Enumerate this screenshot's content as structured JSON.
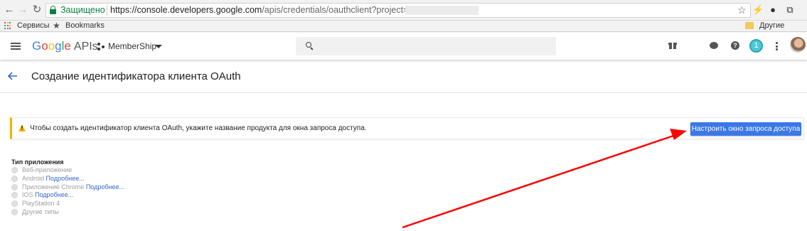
{
  "browser": {
    "secure_label": "Защищено",
    "url_main": "https://console.developers.google.com",
    "url_rest": "/apis/credentials/oauthclient?project=membership-",
    "bookmarks": [
      "Сервисы",
      "Bookmarks"
    ],
    "other_bookmarks": "Другие заклад"
  },
  "header": {
    "logo_letters": [
      "G",
      "o",
      "o",
      "g",
      "l",
      "e"
    ],
    "logo_suffix": "APIs",
    "project": "MemberShip",
    "notification_count": "1"
  },
  "page": {
    "title": "Создание идентификатора клиента OAuth"
  },
  "banner": {
    "text": "Чтобы создать идентификатор клиента OAuth, укажите название продукта для окна запроса доступа.",
    "button_label": "Настроить окно запроса доступа"
  },
  "app_type": {
    "label": "Тип приложения",
    "options": [
      {
        "label": "Веб-приложение",
        "more": ""
      },
      {
        "label": "Android",
        "more": "Подробнее..."
      },
      {
        "label": "Приложение Chrome",
        "more": "Подробнее..."
      },
      {
        "label": "IOS",
        "more": "Подробнее..."
      },
      {
        "label": "PlayStation 4",
        "more": ""
      },
      {
        "label": "Другие типы",
        "more": ""
      }
    ]
  },
  "colors": {
    "primary_button": "#3b78e7",
    "warning": "#f4b400",
    "link": "#3367d6",
    "secure": "#0b8043",
    "annotation_arrow": "#ff0000"
  }
}
